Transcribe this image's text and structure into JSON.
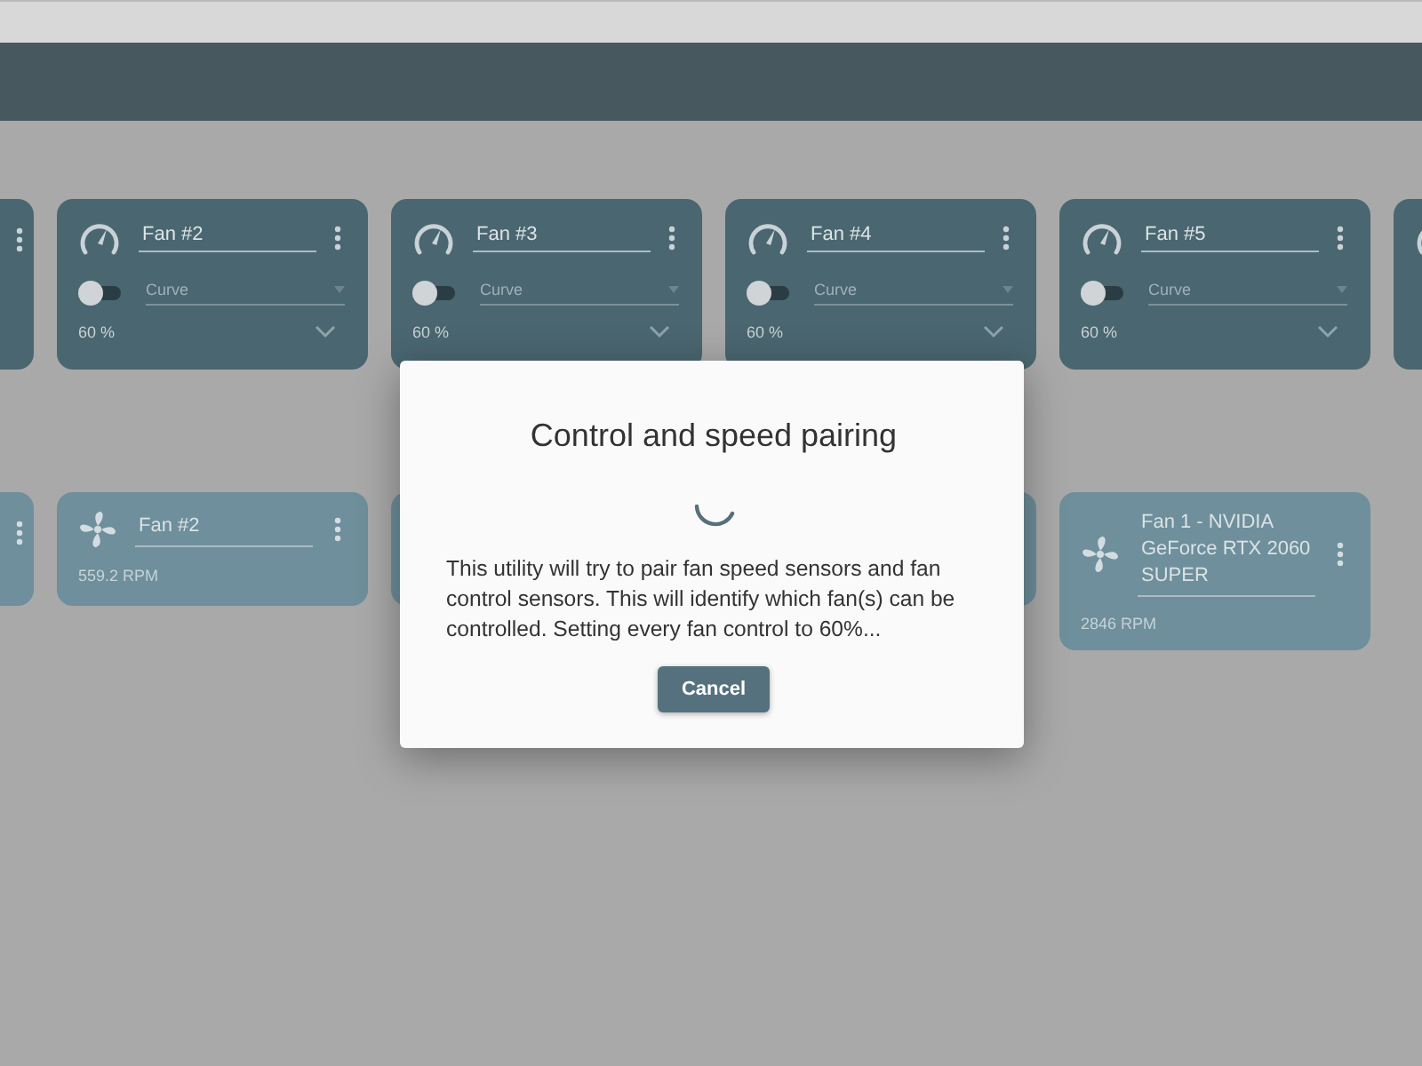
{
  "controls": [
    {
      "name": "Fan #2",
      "on": false,
      "mode_placeholder": "Curve",
      "value": "60 %"
    },
    {
      "name": "Fan #3",
      "on": false,
      "mode_placeholder": "Curve",
      "value": "60 %"
    },
    {
      "name": "Fan #4",
      "on": false,
      "mode_placeholder": "Curve",
      "value": "60 %"
    },
    {
      "name": "Fan #5",
      "on": false,
      "mode_placeholder": "Curve",
      "value": "60 %"
    }
  ],
  "sensors": [
    {
      "name": "Fan #2",
      "reading": "559.2 RPM"
    },
    {
      "name": "Fan 1 - NVIDIA GeForce RTX 2060 SUPER",
      "reading": "2846 RPM"
    }
  ],
  "dialog": {
    "title": "Control and speed pairing",
    "message": "This utility will try to pair fan speed sensors and fan control sensors. This will identify which fan(s) can be controlled. Setting every fan control to 60%...",
    "button": "Cancel"
  }
}
